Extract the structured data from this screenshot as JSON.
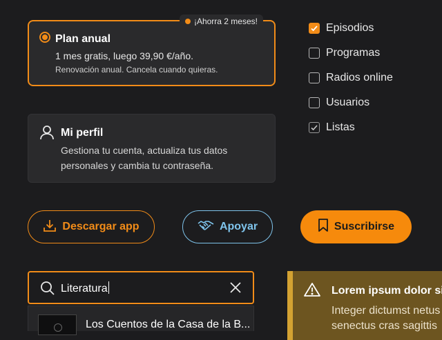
{
  "plan_card": {
    "badge": "¡Ahorra 2 meses!",
    "title": "Plan anual",
    "price": "1 mes gratis, luego 39,90 €/año.",
    "note": "Renovación anual. Cancela cuando quieras.",
    "selected": true
  },
  "profile_card": {
    "icon": "user-icon",
    "title": "Mi perfil",
    "description": "Gestiona tu cuenta, actualiza tus datos personales y cambia tu contraseña."
  },
  "filters": [
    {
      "label": "Episodios",
      "checked": true,
      "style": "orange"
    },
    {
      "label": "Programas",
      "checked": false
    },
    {
      "label": "Radios online",
      "checked": false
    },
    {
      "label": "Usuarios",
      "checked": false
    },
    {
      "label": "Listas",
      "checked": true,
      "style": "grey"
    }
  ],
  "buttons": {
    "download": {
      "label": "Descargar app",
      "icon": "download-icon"
    },
    "support": {
      "label": "Apoyar",
      "icon": "handshake-icon"
    },
    "subscribe": {
      "label": "Suscribirse",
      "icon": "bookmark-icon"
    }
  },
  "search": {
    "value": "Literatura",
    "results": [
      {
        "title": "Los Cuentos de la Casa de la B..."
      }
    ]
  },
  "alert": {
    "icon": "warning-icon",
    "title": "Lorem ipsum dolor sit",
    "body_line1": "Integer dictumst netus",
    "body_line2": "senectus cras sagittis"
  },
  "colors": {
    "accent": "#f28c18",
    "support": "#7fc4ec",
    "alert_bg": "#6d5520",
    "alert_border": "#d3a232"
  }
}
